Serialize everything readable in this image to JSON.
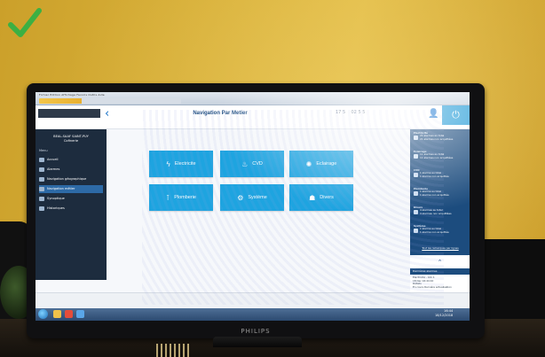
{
  "badge": {
    "icon": "checkmark-icon",
    "color": "#3cb043"
  },
  "monitor": {
    "brand": "PHILIPS"
  },
  "app": {
    "title": "Navigation Par Metier",
    "site_name_line1": "BEAL-SAAF SAINT-PUY",
    "site_name_line2": "Cofinerie",
    "status_counters": [
      "17 5",
      "02 5 5"
    ],
    "colors": {
      "tile": "#1ea4e0",
      "sidebar": "#1d2c3e",
      "panel": "#1c4c7e"
    }
  },
  "sidebar": {
    "menu_header": "Menu",
    "items": [
      {
        "label": "Accueil",
        "icon": "home-icon"
      },
      {
        "label": "Alarmes",
        "icon": "bell-icon"
      },
      {
        "label": "Navigation géographique",
        "icon": "map-icon"
      },
      {
        "label": "Navigation métier",
        "icon": "tools-icon",
        "active": true
      },
      {
        "label": "Synoptique",
        "icon": "diagram-icon"
      },
      {
        "label": "Historiques",
        "icon": "chart-icon"
      }
    ]
  },
  "tiles": [
    {
      "label": "Electricite",
      "icon": "lightning-icon"
    },
    {
      "label": "CVD",
      "icon": "flame-icon"
    },
    {
      "label": "Eclairage",
      "icon": "bulb-icon"
    },
    {
      "label": "Plomberie",
      "icon": "faucet-icon"
    },
    {
      "label": "Système",
      "icon": "gears-icon"
    },
    {
      "label": "Divers",
      "icon": "misc-icon"
    }
  ],
  "right_panel": {
    "sections": [
      {
        "title": "Electricité",
        "lines": [
          "21 alarmes au total",
          "21 alarmes non acquittées"
        ]
      },
      {
        "title": "Eclairage",
        "lines": [
          "11 alarmes au total",
          "11 alarmes non acquittées"
        ]
      },
      {
        "title": "CVD",
        "lines": [
          "1 alarme au total",
          "1 alarme non acquittée"
        ]
      },
      {
        "title": "Plomberie",
        "lines": [
          "1 alarme au total",
          "1 alarme non acquittée"
        ]
      },
      {
        "title": "Divers",
        "lines": [
          "4 alarmes au total",
          "4 alarmes non acquittées"
        ]
      },
      {
        "title": "Système",
        "lines": [
          "1 alarme au total",
          "1 alarme non acquittée"
        ]
      }
    ],
    "link": "Tout les remarques par lignes",
    "alarms_header": "Dernières alarmes",
    "alarm_lines": [
      "Electricité - Info 1",
      "18 Dec 16:44:10",
      "Détails",
      "En cours    Dernière actualisation"
    ]
  },
  "taskbar": {
    "clock_time": "16:44",
    "clock_date": "18/12/2018"
  },
  "browser": {
    "menu_text": "Fichier  Edition  Affichage  Favoris  Outils  Aide"
  }
}
